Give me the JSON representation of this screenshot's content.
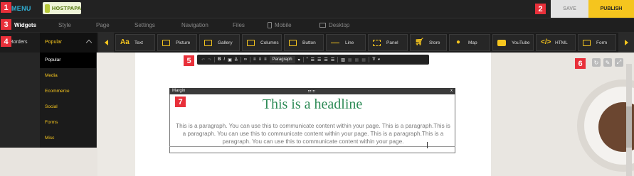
{
  "topbar": {
    "menu_label": "MENU",
    "logo_text": "HOSTPAPA",
    "save_label": "SAVE",
    "publish_label": "PUBLISH"
  },
  "tabs": [
    {
      "label": "Widgets",
      "active": true
    },
    {
      "label": "Style"
    },
    {
      "label": "Page"
    },
    {
      "label": "Settings"
    },
    {
      "label": "Navigation"
    },
    {
      "label": "Files"
    },
    {
      "label": "Mobile",
      "icon": "mobile-icon"
    },
    {
      "label": "Desktop",
      "icon": "desktop-icon"
    }
  ],
  "widgetbar": {
    "borders_label": "Borders",
    "category": "Popular",
    "items": [
      {
        "label": "Text",
        "icon": "text-icon"
      },
      {
        "label": "Picture",
        "icon": "picture-icon"
      },
      {
        "label": "Gallery",
        "icon": "gallery-icon"
      },
      {
        "label": "Columns",
        "icon": "columns-icon"
      },
      {
        "label": "Button",
        "icon": "button-icon"
      },
      {
        "label": "Line",
        "icon": "line-icon"
      },
      {
        "label": "Panel",
        "icon": "panel-icon"
      },
      {
        "label": "Store",
        "icon": "cart-icon"
      },
      {
        "label": "Map",
        "icon": "map-pin-icon"
      },
      {
        "label": "YouTube",
        "icon": "youtube-icon"
      },
      {
        "label": "HTML",
        "icon": "code-icon"
      },
      {
        "label": "Form",
        "icon": "form-icon"
      }
    ]
  },
  "dropdown": {
    "items": [
      "Popular",
      "Media",
      "Ecommerce",
      "Social",
      "Forms",
      "Misc"
    ]
  },
  "rte": {
    "b": "B",
    "i": "I",
    "paragraph": "Paragraph"
  },
  "element": {
    "label": "Margin",
    "close": "x",
    "headline": "This is a headline",
    "paragraph": "This is a paragraph. You can use this to communicate content within your page. This is a paragraph.This is a paragraph. You can use this to communicate content within your page. This is a paragraph.This is a paragraph. You can use this to communicate content within your page."
  },
  "badges": [
    "1",
    "2",
    "3",
    "4",
    "5",
    "6",
    "7"
  ],
  "colors": {
    "accent": "#f5c51e",
    "badge": "#e8303a",
    "headline": "#2e8b57",
    "menu": "#31b0d5"
  }
}
